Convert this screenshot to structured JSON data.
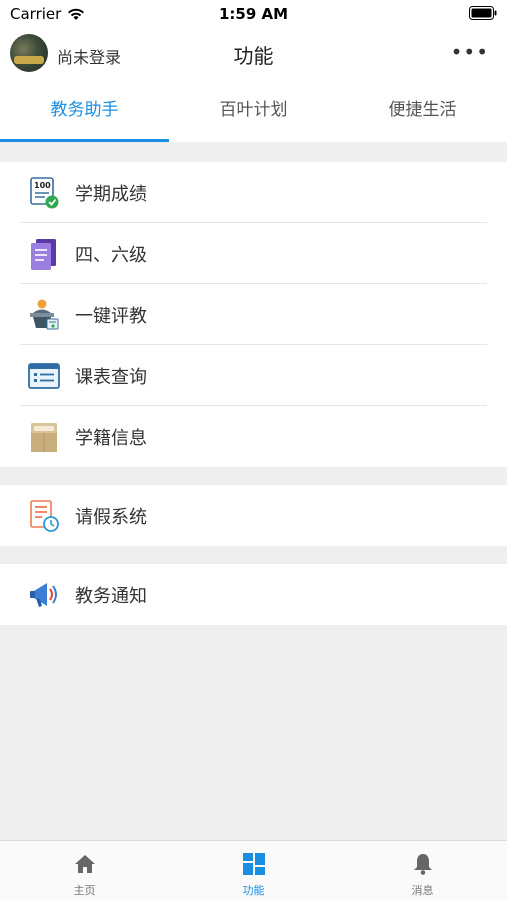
{
  "status_bar": {
    "carrier": "Carrier",
    "time": "1:59 AM"
  },
  "nav": {
    "login_text": "尚未登录",
    "title": "功能",
    "more": "•••"
  },
  "tabs": [
    {
      "label": "教务助手",
      "active": true
    },
    {
      "label": "百叶计划",
      "active": false
    },
    {
      "label": "便捷生活",
      "active": false
    }
  ],
  "groups": {
    "academic": [
      {
        "label": "学期成绩",
        "icon": "score-100-icon"
      },
      {
        "label": "四、六级",
        "icon": "document-purple-icon"
      },
      {
        "label": "一键评教",
        "icon": "teacher-podium-icon"
      },
      {
        "label": "课表查询",
        "icon": "schedule-list-icon"
      },
      {
        "label": "学籍信息",
        "icon": "folder-card-icon"
      }
    ],
    "leave": [
      {
        "label": "请假系统",
        "icon": "leave-clock-icon"
      }
    ],
    "notice": [
      {
        "label": "教务通知",
        "icon": "megaphone-icon"
      }
    ]
  },
  "bottom_tabs": [
    {
      "label": "主页",
      "icon": "home-icon",
      "active": false
    },
    {
      "label": "功能",
      "icon": "grid-icon",
      "active": true
    },
    {
      "label": "消息",
      "icon": "bell-icon",
      "active": false
    }
  ],
  "colors": {
    "accent": "#1a8ee3",
    "background": "#efefef"
  }
}
